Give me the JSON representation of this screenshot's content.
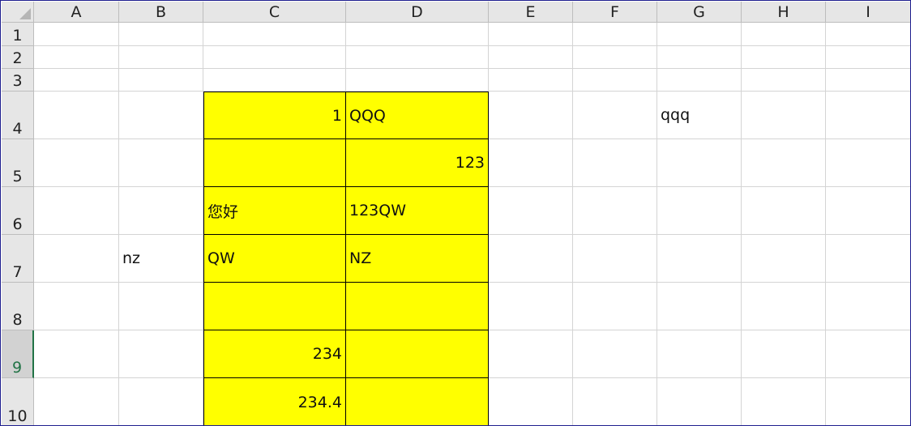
{
  "columns": [
    "A",
    "B",
    "C",
    "D",
    "E",
    "F",
    "G",
    "H",
    "I"
  ],
  "rows": [
    "1",
    "2",
    "3",
    "4",
    "5",
    "6",
    "7",
    "8",
    "9",
    "10"
  ],
  "active_row": "9",
  "fill_color": "#ffff00",
  "filled_range": {
    "columns": [
      "C",
      "D"
    ],
    "rows": [
      "4",
      "5",
      "6",
      "7",
      "8",
      "9",
      "10"
    ]
  },
  "cells": [
    {
      "ref": "C4",
      "value": "1",
      "align": "right"
    },
    {
      "ref": "D4",
      "value": "QQQ",
      "align": "left"
    },
    {
      "ref": "G4",
      "value": "qqq",
      "align": "left"
    },
    {
      "ref": "D5",
      "value": "123",
      "align": "right"
    },
    {
      "ref": "C6",
      "value": "您好",
      "align": "left"
    },
    {
      "ref": "D6",
      "value": "123QW",
      "align": "left"
    },
    {
      "ref": "B7",
      "value": "nz",
      "align": "left"
    },
    {
      "ref": "C7",
      "value": "QW",
      "align": "left"
    },
    {
      "ref": "D7",
      "value": "NZ",
      "align": "left"
    },
    {
      "ref": "C9",
      "value": "234",
      "align": "right"
    },
    {
      "ref": "C10",
      "value": "234.4",
      "align": "right"
    }
  ]
}
